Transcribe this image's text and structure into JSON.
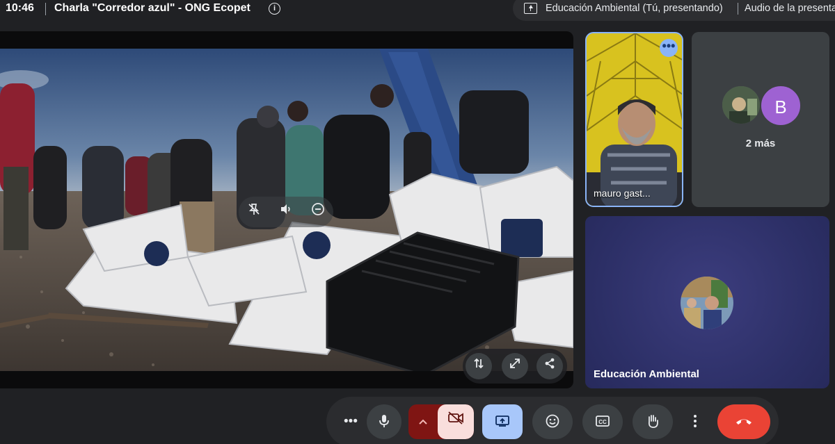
{
  "topbar": {
    "time": "10:46",
    "meeting_title": "Charla \"Corredor azul\" - ONG Ecopet",
    "info_icon": "info-icon",
    "presenting_text": "Educación Ambiental (Tú, presentando)",
    "audio_text": "Audio de la presentación"
  },
  "stage": {
    "icons": [
      "pin-off-icon",
      "volume-icon",
      "remove-icon"
    ],
    "share_tools": [
      "swap-icon",
      "fullscreen-icon",
      "share-icon"
    ]
  },
  "participants": {
    "mauro": {
      "name": "mauro gast..."
    },
    "others": {
      "avatar_letter": "B",
      "more_label": "2 más"
    },
    "presenter": {
      "name": "Educación Ambiental"
    }
  },
  "controls": {
    "items": [
      "more-options-icon",
      "microphone-icon",
      "chevron-up-icon",
      "camera-off-icon",
      "present-screen-icon",
      "emoji-icon",
      "captions-icon",
      "raise-hand-icon",
      "more-vert-icon",
      "end-call-icon"
    ],
    "colors": {
      "camera_off": "#f9dedc",
      "present": "#a8c7fa",
      "end_call": "#ea4335",
      "accent": "#8ab4f8"
    }
  }
}
